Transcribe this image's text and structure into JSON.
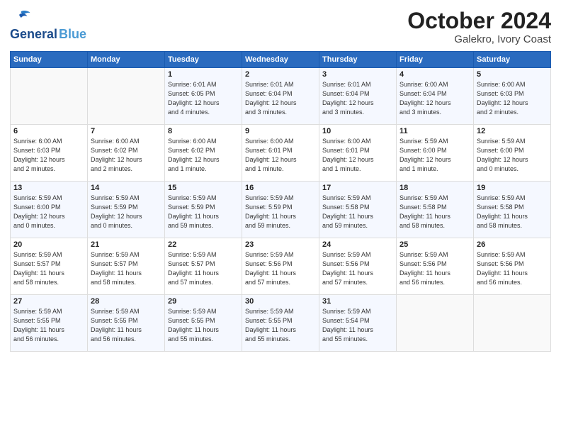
{
  "logo": {
    "line1": "General",
    "line2": "Blue"
  },
  "title": "October 2024",
  "subtitle": "Galekro, Ivory Coast",
  "days_header": [
    "Sunday",
    "Monday",
    "Tuesday",
    "Wednesday",
    "Thursday",
    "Friday",
    "Saturday"
  ],
  "weeks": [
    [
      {
        "day": "",
        "info": ""
      },
      {
        "day": "",
        "info": ""
      },
      {
        "day": "1",
        "info": "Sunrise: 6:01 AM\nSunset: 6:05 PM\nDaylight: 12 hours\nand 4 minutes."
      },
      {
        "day": "2",
        "info": "Sunrise: 6:01 AM\nSunset: 6:04 PM\nDaylight: 12 hours\nand 3 minutes."
      },
      {
        "day": "3",
        "info": "Sunrise: 6:01 AM\nSunset: 6:04 PM\nDaylight: 12 hours\nand 3 minutes."
      },
      {
        "day": "4",
        "info": "Sunrise: 6:00 AM\nSunset: 6:04 PM\nDaylight: 12 hours\nand 3 minutes."
      },
      {
        "day": "5",
        "info": "Sunrise: 6:00 AM\nSunset: 6:03 PM\nDaylight: 12 hours\nand 2 minutes."
      }
    ],
    [
      {
        "day": "6",
        "info": "Sunrise: 6:00 AM\nSunset: 6:03 PM\nDaylight: 12 hours\nand 2 minutes."
      },
      {
        "day": "7",
        "info": "Sunrise: 6:00 AM\nSunset: 6:02 PM\nDaylight: 12 hours\nand 2 minutes."
      },
      {
        "day": "8",
        "info": "Sunrise: 6:00 AM\nSunset: 6:02 PM\nDaylight: 12 hours\nand 1 minute."
      },
      {
        "day": "9",
        "info": "Sunrise: 6:00 AM\nSunset: 6:01 PM\nDaylight: 12 hours\nand 1 minute."
      },
      {
        "day": "10",
        "info": "Sunrise: 6:00 AM\nSunset: 6:01 PM\nDaylight: 12 hours\nand 1 minute."
      },
      {
        "day": "11",
        "info": "Sunrise: 5:59 AM\nSunset: 6:00 PM\nDaylight: 12 hours\nand 1 minute."
      },
      {
        "day": "12",
        "info": "Sunrise: 5:59 AM\nSunset: 6:00 PM\nDaylight: 12 hours\nand 0 minutes."
      }
    ],
    [
      {
        "day": "13",
        "info": "Sunrise: 5:59 AM\nSunset: 6:00 PM\nDaylight: 12 hours\nand 0 minutes."
      },
      {
        "day": "14",
        "info": "Sunrise: 5:59 AM\nSunset: 5:59 PM\nDaylight: 12 hours\nand 0 minutes."
      },
      {
        "day": "15",
        "info": "Sunrise: 5:59 AM\nSunset: 5:59 PM\nDaylight: 11 hours\nand 59 minutes."
      },
      {
        "day": "16",
        "info": "Sunrise: 5:59 AM\nSunset: 5:59 PM\nDaylight: 11 hours\nand 59 minutes."
      },
      {
        "day": "17",
        "info": "Sunrise: 5:59 AM\nSunset: 5:58 PM\nDaylight: 11 hours\nand 59 minutes."
      },
      {
        "day": "18",
        "info": "Sunrise: 5:59 AM\nSunset: 5:58 PM\nDaylight: 11 hours\nand 58 minutes."
      },
      {
        "day": "19",
        "info": "Sunrise: 5:59 AM\nSunset: 5:58 PM\nDaylight: 11 hours\nand 58 minutes."
      }
    ],
    [
      {
        "day": "20",
        "info": "Sunrise: 5:59 AM\nSunset: 5:57 PM\nDaylight: 11 hours\nand 58 minutes."
      },
      {
        "day": "21",
        "info": "Sunrise: 5:59 AM\nSunset: 5:57 PM\nDaylight: 11 hours\nand 58 minutes."
      },
      {
        "day": "22",
        "info": "Sunrise: 5:59 AM\nSunset: 5:57 PM\nDaylight: 11 hours\nand 57 minutes."
      },
      {
        "day": "23",
        "info": "Sunrise: 5:59 AM\nSunset: 5:56 PM\nDaylight: 11 hours\nand 57 minutes."
      },
      {
        "day": "24",
        "info": "Sunrise: 5:59 AM\nSunset: 5:56 PM\nDaylight: 11 hours\nand 57 minutes."
      },
      {
        "day": "25",
        "info": "Sunrise: 5:59 AM\nSunset: 5:56 PM\nDaylight: 11 hours\nand 56 minutes."
      },
      {
        "day": "26",
        "info": "Sunrise: 5:59 AM\nSunset: 5:56 PM\nDaylight: 11 hours\nand 56 minutes."
      }
    ],
    [
      {
        "day": "27",
        "info": "Sunrise: 5:59 AM\nSunset: 5:55 PM\nDaylight: 11 hours\nand 56 minutes."
      },
      {
        "day": "28",
        "info": "Sunrise: 5:59 AM\nSunset: 5:55 PM\nDaylight: 11 hours\nand 56 minutes."
      },
      {
        "day": "29",
        "info": "Sunrise: 5:59 AM\nSunset: 5:55 PM\nDaylight: 11 hours\nand 55 minutes."
      },
      {
        "day": "30",
        "info": "Sunrise: 5:59 AM\nSunset: 5:55 PM\nDaylight: 11 hours\nand 55 minutes."
      },
      {
        "day": "31",
        "info": "Sunrise: 5:59 AM\nSunset: 5:54 PM\nDaylight: 11 hours\nand 55 minutes."
      },
      {
        "day": "",
        "info": ""
      },
      {
        "day": "",
        "info": ""
      }
    ]
  ]
}
